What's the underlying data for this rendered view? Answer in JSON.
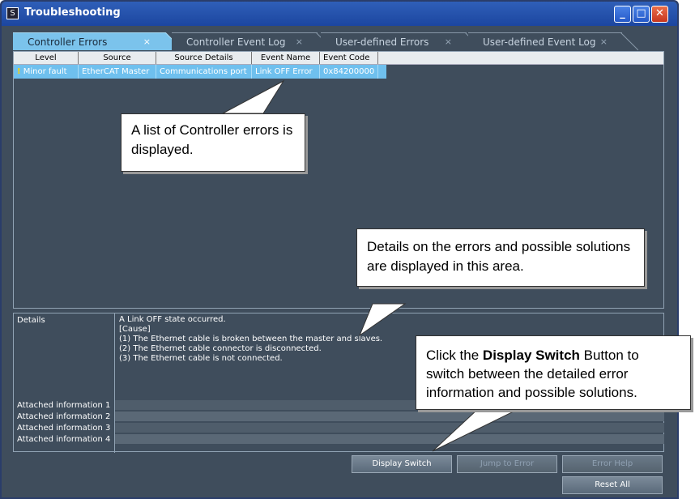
{
  "window": {
    "title": "Troubleshooting",
    "min_label": "_",
    "max_label": "□",
    "close_label": "✕"
  },
  "tabs": [
    {
      "label": "Controller Errors",
      "close": "×",
      "active": true
    },
    {
      "label": "Controller Event Log",
      "close": "×",
      "active": false
    },
    {
      "label": "User-defined Errors",
      "close": "×",
      "active": false
    },
    {
      "label": "User-defined Event Log",
      "close": "×",
      "active": false
    }
  ],
  "table": {
    "headers": [
      "Level",
      "Source",
      "Source Details",
      "Event Name",
      "Event Code"
    ],
    "rows": [
      {
        "level_icon": "!",
        "level": "Minor fault",
        "source": "EtherCAT Master",
        "source_details": "Communications port",
        "event_name": "Link OFF Error",
        "event_code": "0x84200000"
      }
    ]
  },
  "details": {
    "label": "Details",
    "lines": [
      "A Link OFF state occurred.",
      "[Cause]",
      "(1) The Ethernet cable is broken between the master and slaves.",
      "(2) The Ethernet cable connector is disconnected.",
      "(3) The Ethernet cable is not connected."
    ],
    "attached": [
      "Attached information 1",
      "Attached information 2",
      "Attached information 3",
      "Attached information 4"
    ]
  },
  "buttons": {
    "display_switch": "Display Switch",
    "jump_to_error": "Jump to Error",
    "error_help": "Error Help",
    "reset_all": "Reset All"
  },
  "callouts": {
    "list": "A list of Controller errors is displayed.",
    "details": "Details on the errors and possible solutions are displayed in this area.",
    "switch_prefix": "Click the ",
    "switch_bold": "Display Switch",
    "switch_suffix": " Button to switch between the detailed error information and possible solutions."
  },
  "colors": {
    "accent_selected": "#6fc0ee",
    "panel_bg": "#3f4d5c",
    "title_blue": "#1c46a0"
  }
}
